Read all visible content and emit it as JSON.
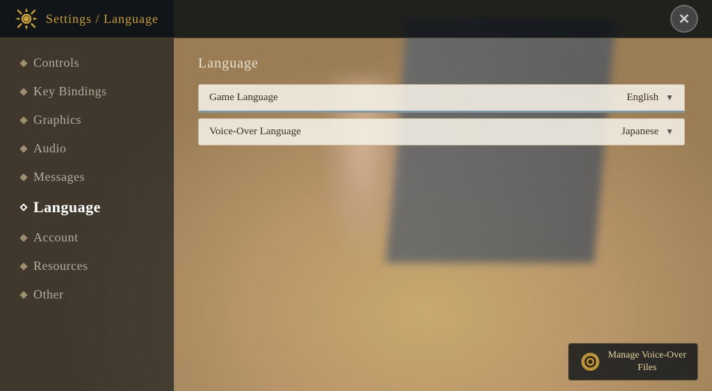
{
  "header": {
    "title": "Settings / Language",
    "close_label": "✕",
    "gear_icon": "gear-icon"
  },
  "sidebar": {
    "items": [
      {
        "id": "controls",
        "label": "Controls",
        "active": false
      },
      {
        "id": "key-bindings",
        "label": "Key Bindings",
        "active": false
      },
      {
        "id": "graphics",
        "label": "Graphics",
        "active": false
      },
      {
        "id": "audio",
        "label": "Audio",
        "active": false
      },
      {
        "id": "messages",
        "label": "Messages",
        "active": false
      },
      {
        "id": "language",
        "label": "Language",
        "active": true
      },
      {
        "id": "account",
        "label": "Account",
        "active": false
      },
      {
        "id": "resources",
        "label": "Resources",
        "active": false
      },
      {
        "id": "other",
        "label": "Other",
        "active": false
      }
    ]
  },
  "main": {
    "section_title": "Language",
    "dropdowns": [
      {
        "id": "game-language",
        "label": "Game Language",
        "value": "English",
        "active_border": true
      },
      {
        "id": "voice-over-language",
        "label": "Voice-Over Language",
        "value": "Japanese",
        "active_border": false
      }
    ]
  },
  "footer": {
    "voice_over_btn_line1": "Manage Voice-Over",
    "voice_over_btn_line2": "Files"
  }
}
